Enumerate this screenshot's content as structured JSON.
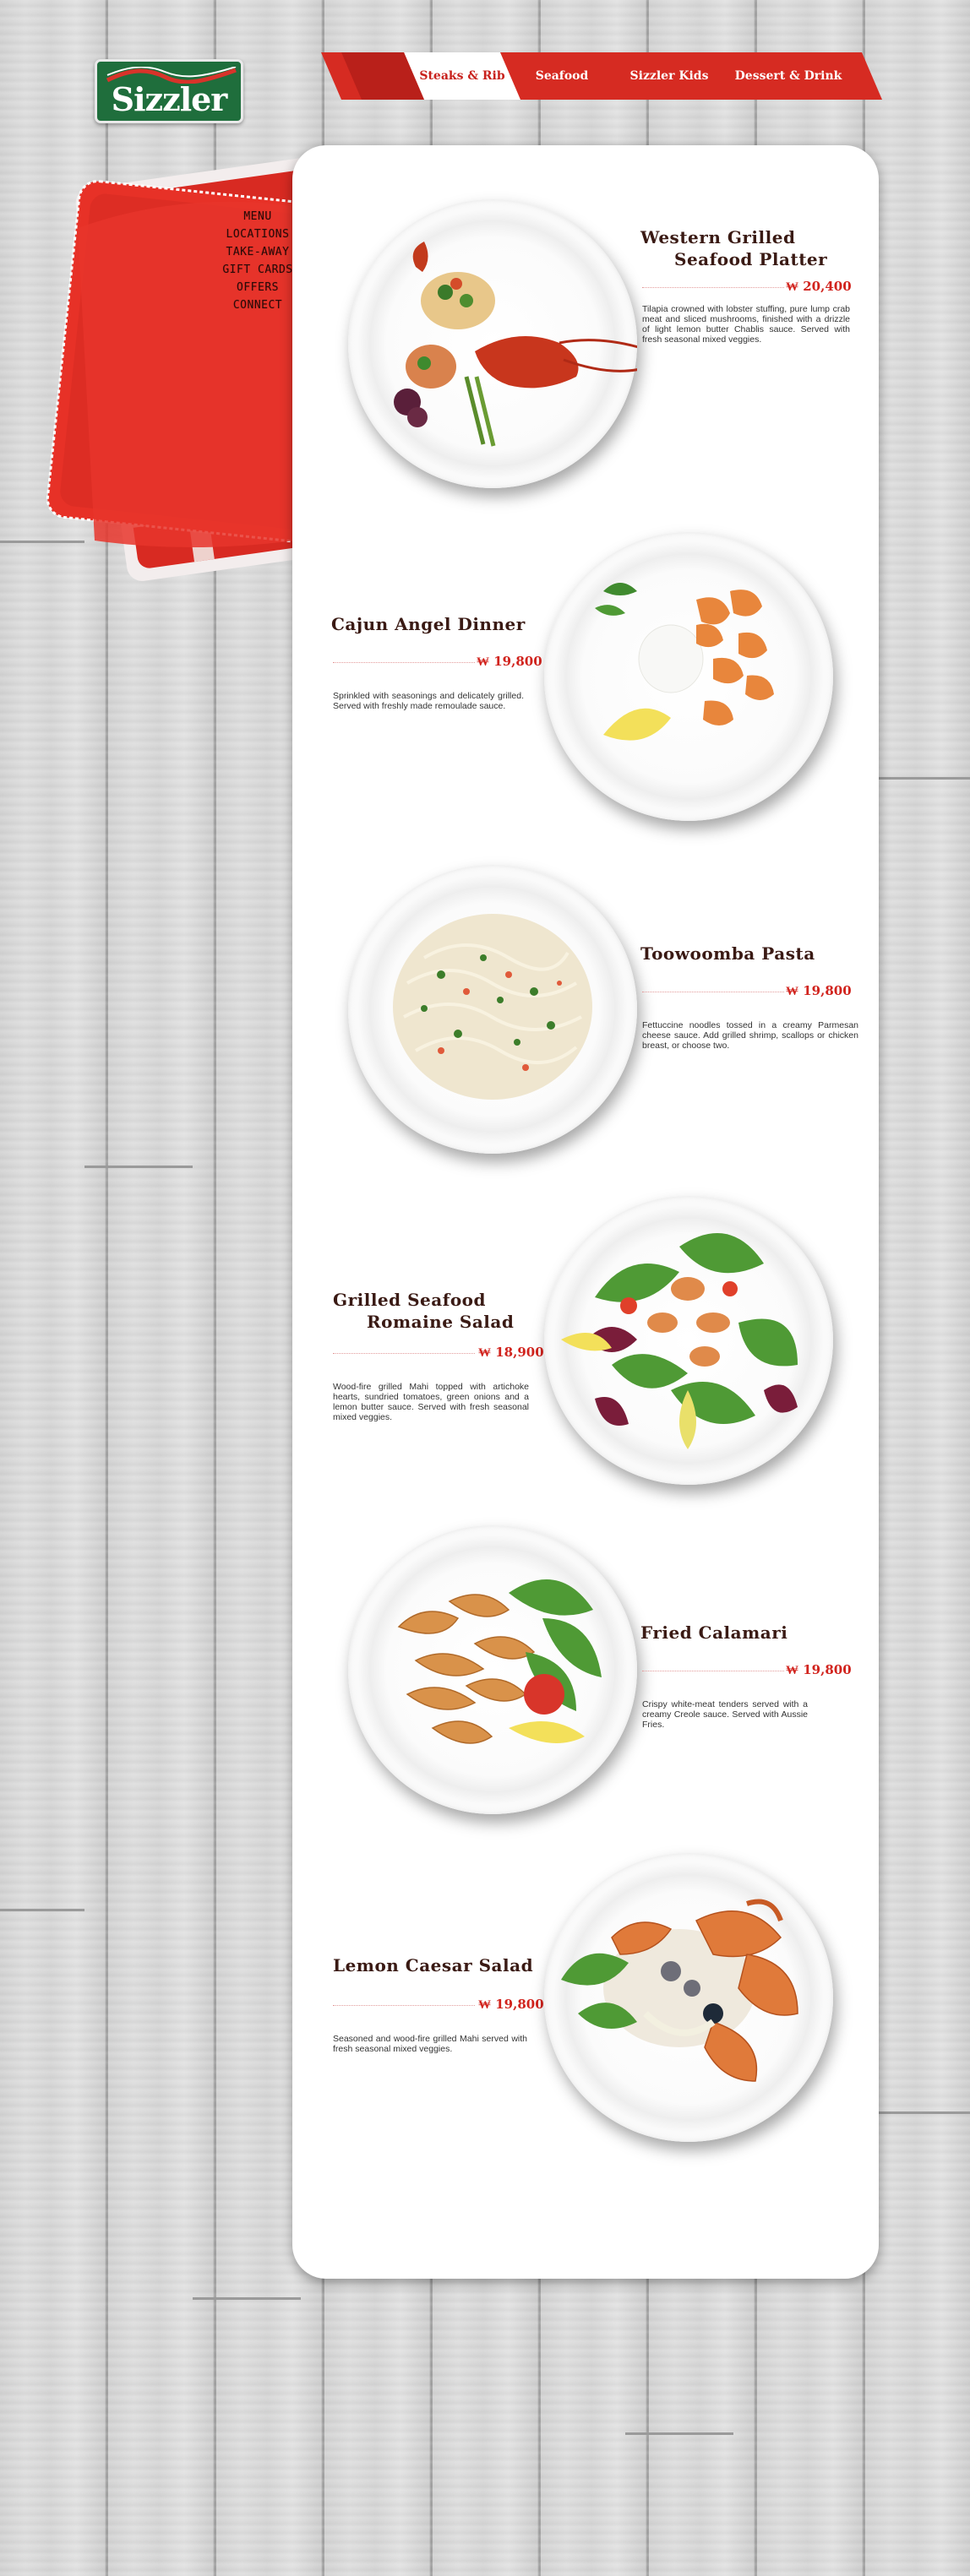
{
  "brand": {
    "logo_text": "Sizzler",
    "colors": {
      "brand_green": "#1f6e3c",
      "accent_red": "#d1231d"
    }
  },
  "topnav": {
    "items": [
      {
        "label": "Steaks & Rib",
        "active": true
      },
      {
        "label": "Seafood",
        "active": false
      },
      {
        "label": "Sizzler Kids",
        "active": false
      },
      {
        "label": "Dessert & Drink",
        "active": false
      }
    ]
  },
  "side_menu": {
    "items": [
      "MENU",
      "LOCATIONS",
      "TAKE-AWAY",
      "GIFT CARDS",
      "OFFERS",
      "CONNECT"
    ]
  },
  "dishes": [
    {
      "title_lines": [
        "Western Grilled",
        "Seafood Platter"
      ],
      "price": "₩ 20,400",
      "description": "Tilapia crowned with lobster stuffing, pure lump crab meat and sliced mushrooms, finished with a drizzle of light lemon butter Chablis sauce. Served with fresh seasonal mixed veggies.",
      "image": "lobster-platter-icon"
    },
    {
      "title_lines": [
        "Cajun Angel Dinner"
      ],
      "price": "₩ 19,800",
      "description": "Sprinkled with seasonings and delicately grilled. Served with freshly made remoulade sauce.",
      "image": "shrimp-rice-icon"
    },
    {
      "title_lines": [
        "Toowoomba Pasta"
      ],
      "price": "₩ 19,800",
      "description": "Fettuccine noodles tossed in a creamy Parmesan cheese sauce. Add grilled shrimp, scallops or chicken breast, or choose two.",
      "image": "pasta-icon"
    },
    {
      "title_lines": [
        "Grilled Seafood",
        "Romaine Salad"
      ],
      "price": "₩ 18,900",
      "description": "Wood-fire grilled Mahi topped with artichoke hearts, sundried tomatoes, green onions and a lemon butter sauce. Served with fresh seasonal mixed veggies.",
      "image": "seafood-salad-icon"
    },
    {
      "title_lines": [
        "Fried Calamari"
      ],
      "price": "₩ 19,800",
      "description": "Crispy white-meat tenders served with a creamy Creole sauce. Served with Aussie Fries.",
      "image": "calamari-icon"
    },
    {
      "title_lines": [
        "Lemon Caesar Salad"
      ],
      "price": "₩ 19,800",
      "description": "Seasoned and wood-fire grilled Mahi served with fresh seasonal mixed veggies.",
      "image": "crab-salad-icon"
    }
  ]
}
